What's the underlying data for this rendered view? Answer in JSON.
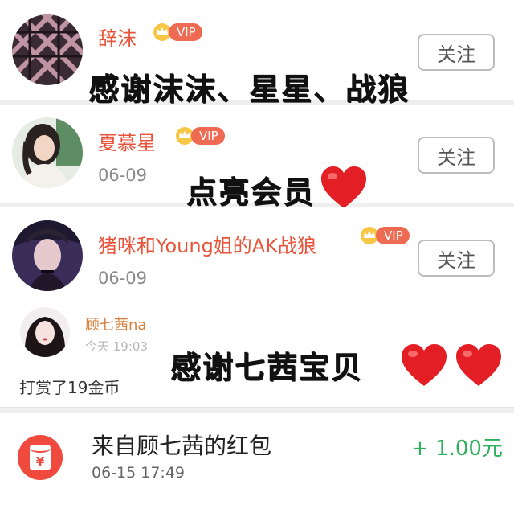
{
  "followers": [
    {
      "name": "辞沫",
      "vip_label": "VIP",
      "follow_label": "关注"
    },
    {
      "name": "夏慕星",
      "vip_label": "VIP",
      "date": "06-09",
      "follow_label": "关注"
    },
    {
      "name": "猪咪和Young姐的AK战狼",
      "vip_label": "VIP",
      "date": "06-09",
      "follow_label": "关注"
    }
  ],
  "overlays": {
    "thanks_1": "感谢沫沫、星星、战狼",
    "thanks_2": "点亮会员",
    "thanks_3": "感谢七茜宝贝"
  },
  "reward": {
    "name": "顾七茜na",
    "time": "今天 19:03",
    "text": "打赏了19金币"
  },
  "red_packet": {
    "icon_glyph": "¥",
    "title": "来自顾七茜的红包",
    "time": "06-15 17:49",
    "amount": "+ 1.00元"
  },
  "colors": {
    "name": "#e8543a",
    "vip": "#ef6a52",
    "heart": "#e31e24",
    "amount": "#2fae5c",
    "red_packet": "#f04a3e"
  }
}
